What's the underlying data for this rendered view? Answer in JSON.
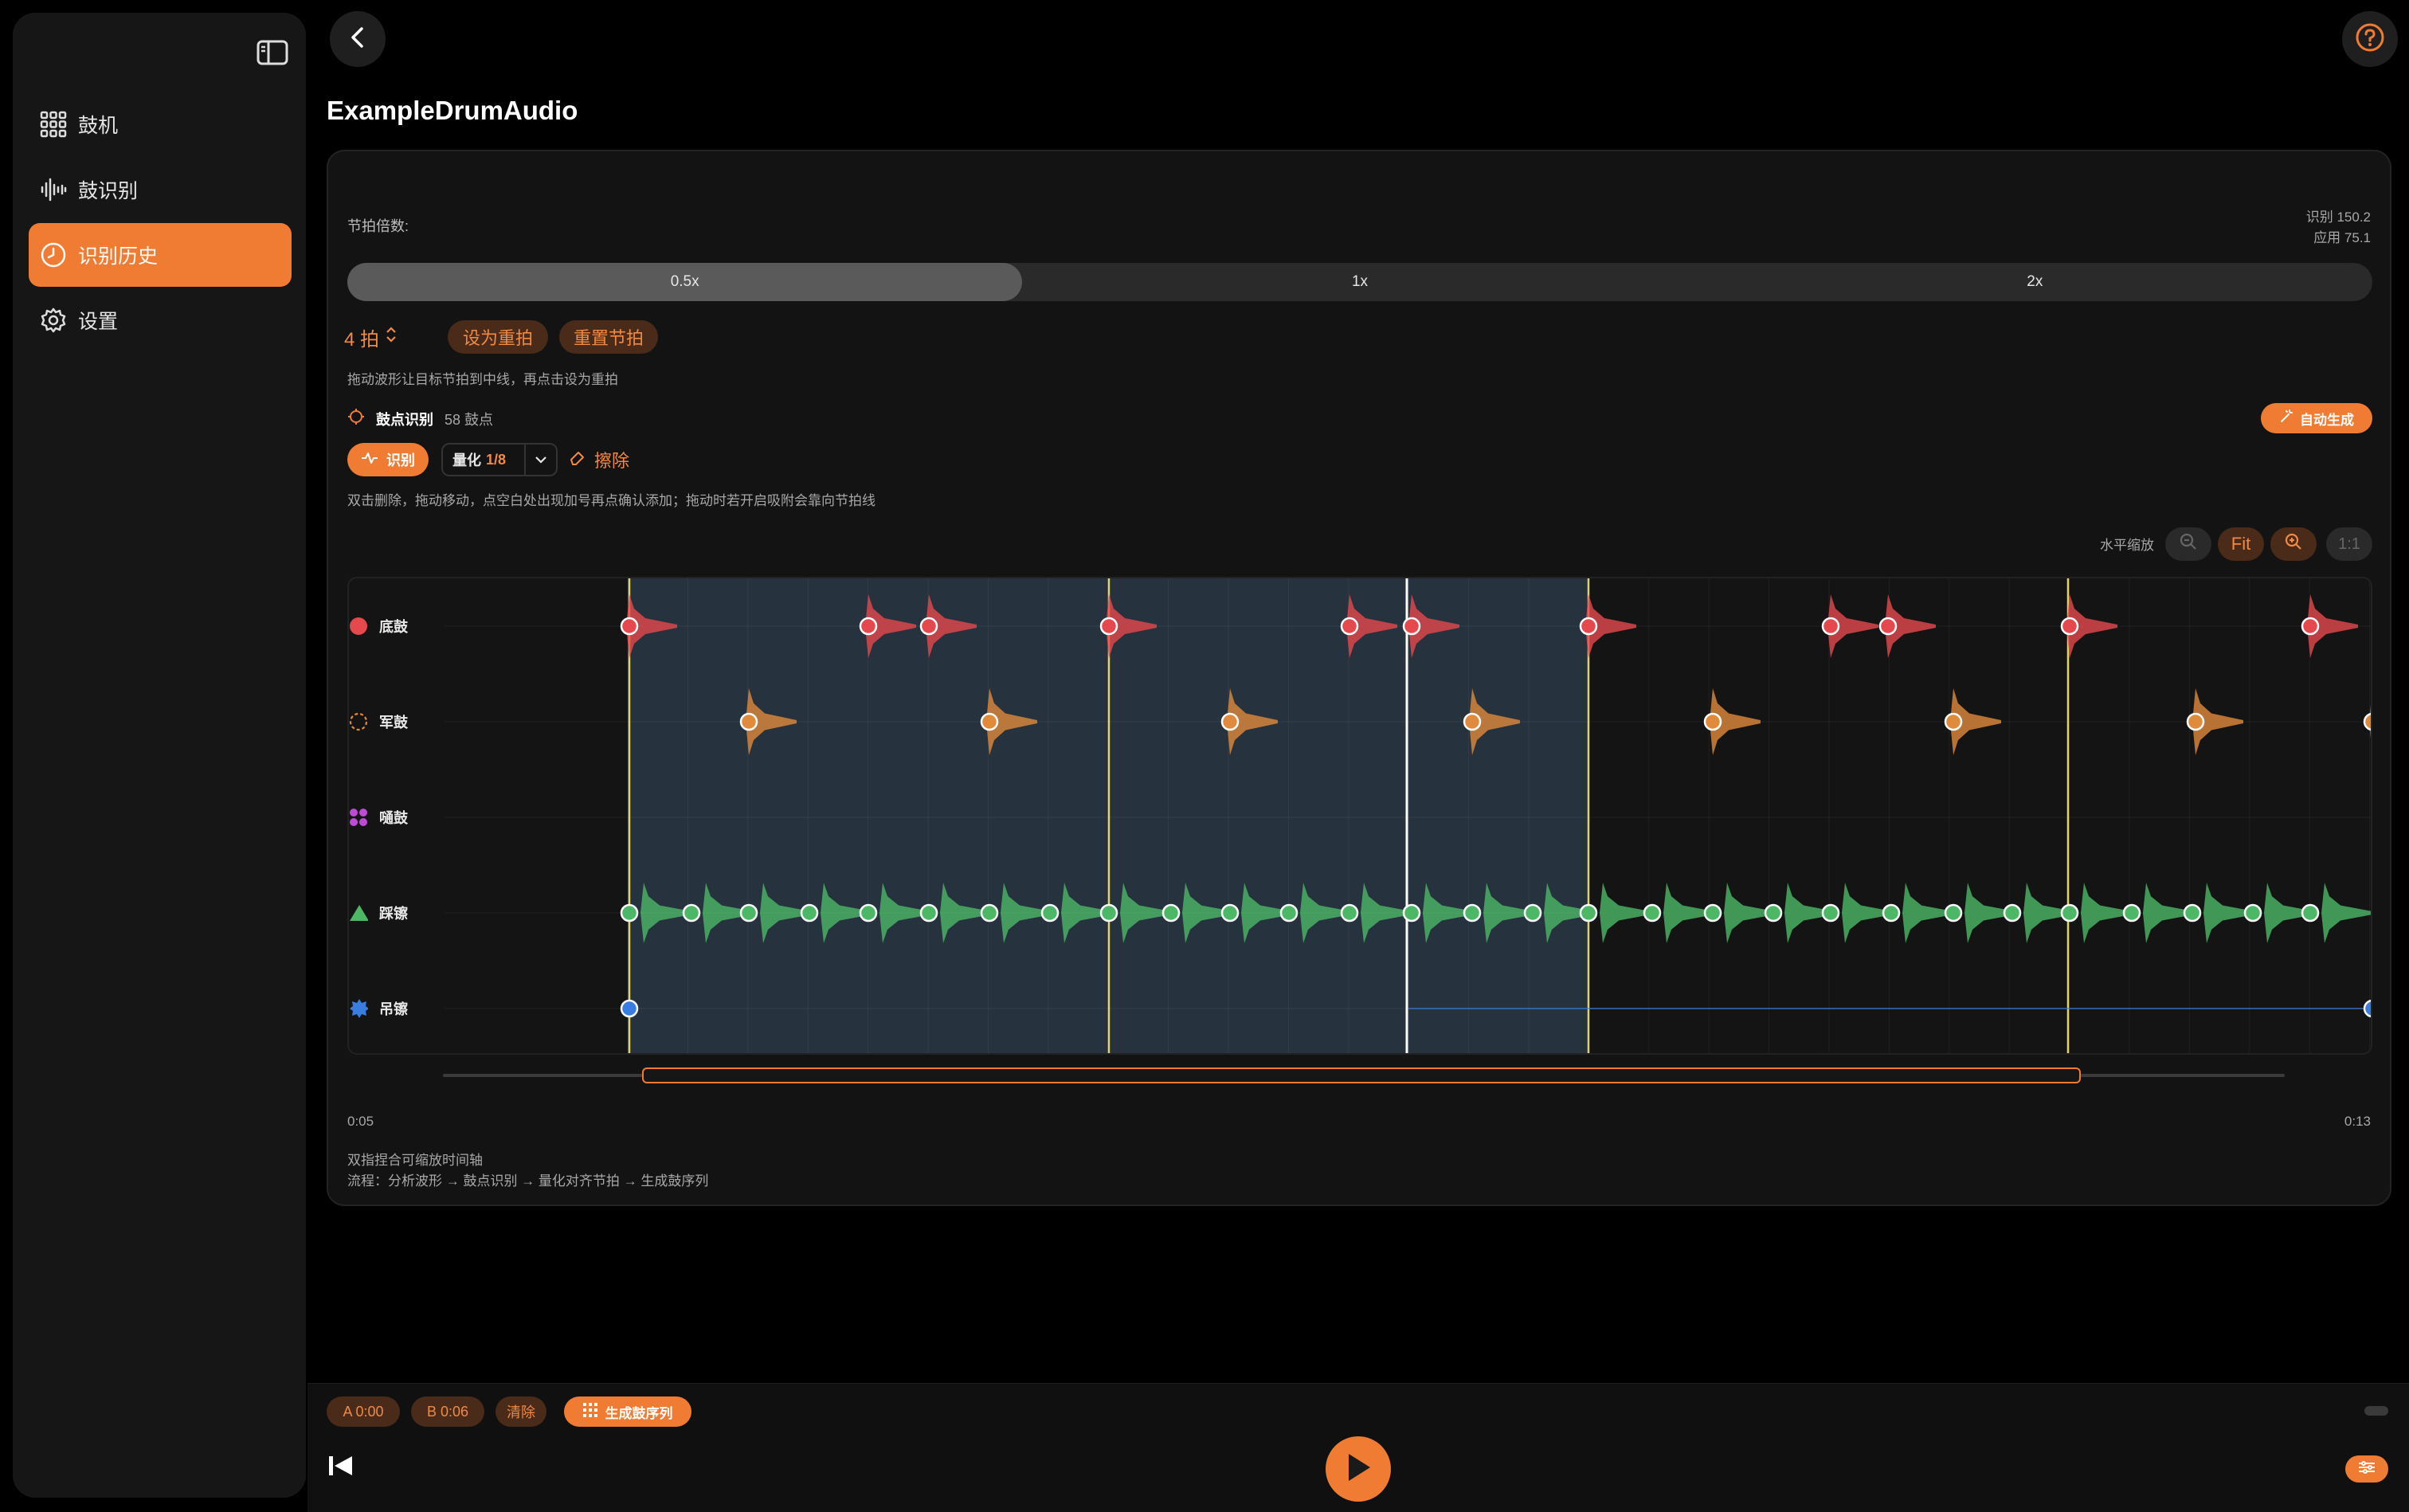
{
  "sidebar": {
    "items": [
      {
        "label": "鼓机",
        "icon": "grid-icon",
        "active": false
      },
      {
        "label": "鼓识别",
        "icon": "waveform-icon",
        "active": false
      },
      {
        "label": "识别历史",
        "icon": "clock-icon",
        "active": true
      },
      {
        "label": "设置",
        "icon": "gear-icon",
        "active": false
      }
    ]
  },
  "header": {
    "title": "ExampleDrumAudio"
  },
  "tempo": {
    "label": "节拍倍数:",
    "detected": "识别 150.2",
    "applied": "应用 75.1",
    "options": [
      "0.5x",
      "1x",
      "2x"
    ],
    "selected": "0.5x"
  },
  "beats": {
    "count_label": "4 拍",
    "set_downbeat": "设为重拍",
    "reset_beat": "重置节拍",
    "hint": "拖动波形让目标节拍到中线，再点击设为重拍"
  },
  "detection": {
    "title": "鼓点识别",
    "count": "58 鼓点",
    "auto_generate": "自动生成",
    "detect_btn": "识别",
    "quantize_label": "量化",
    "quantize_value": "1/8",
    "erase_btn": "擦除",
    "hint": "双击删除，拖动移动，点空白处出现加号再点确认添加；拖动时若开启吸附会靠向节拍线"
  },
  "zoom": {
    "label": "水平缩放",
    "fit": "Fit",
    "one_to_one": "1:1"
  },
  "lanes": [
    {
      "name": "底鼓",
      "color": "#e5484d"
    },
    {
      "name": "军鼓",
      "color": "#e08a3c"
    },
    {
      "name": "嗵鼓",
      "color": "#c04ad8"
    },
    {
      "name": "踩镲",
      "color": "#4cb866"
    },
    {
      "name": "吊镲",
      "color": "#3a7de0"
    }
  ],
  "timeline": {
    "start": "0:05",
    "end": "0:13"
  },
  "footer_hints": {
    "pinch": "双指捏合可缩放时间轴",
    "flow": "流程：分析波形 → 鼓点识别 → 量化对齐节拍 → 生成鼓序列"
  },
  "bottom_bar": {
    "a_marker": "A 0:00",
    "b_marker": "B 0:06",
    "clear": "清除",
    "generate": "生成鼓序列"
  },
  "colors": {
    "accent": "#f07c33",
    "region": "#26323d"
  }
}
